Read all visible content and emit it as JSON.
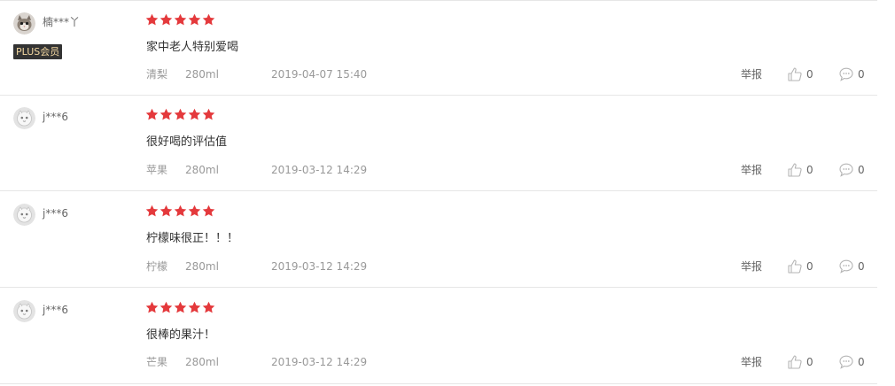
{
  "reviews": [
    {
      "username": "楠***丫",
      "badge": "PLUS会员",
      "avatar": "cat-avatar-icon",
      "stars": 5,
      "content": "家中老人特别爱喝",
      "flavor": "清梨",
      "size": "280ml",
      "date": "2019-04-07 15:40",
      "report_label": "举报",
      "likes": "0",
      "comments": "0"
    },
    {
      "username": "j***6",
      "avatar": "default-avatar-icon",
      "stars": 5,
      "content": "很好喝的评估值",
      "flavor": "苹果",
      "size": "280ml",
      "date": "2019-03-12 14:29",
      "report_label": "举报",
      "likes": "0",
      "comments": "0"
    },
    {
      "username": "j***6",
      "avatar": "default-avatar-icon",
      "stars": 5,
      "content": "柠檬味很正！！！",
      "flavor": "柠檬",
      "size": "280ml",
      "date": "2019-03-12 14:29",
      "report_label": "举报",
      "likes": "0",
      "comments": "0"
    },
    {
      "username": "j***6",
      "avatar": "default-avatar-icon",
      "stars": 5,
      "content": "很棒的果汁！",
      "flavor": "芒果",
      "size": "280ml",
      "date": "2019-03-12 14:29",
      "report_label": "举报",
      "likes": "0",
      "comments": "0"
    }
  ],
  "colors": {
    "star": "#e4393c",
    "badge_bg": "#333333",
    "badge_text": "#f2d7a1",
    "meta_text": "#999999",
    "divider": "#e6e6e6"
  }
}
